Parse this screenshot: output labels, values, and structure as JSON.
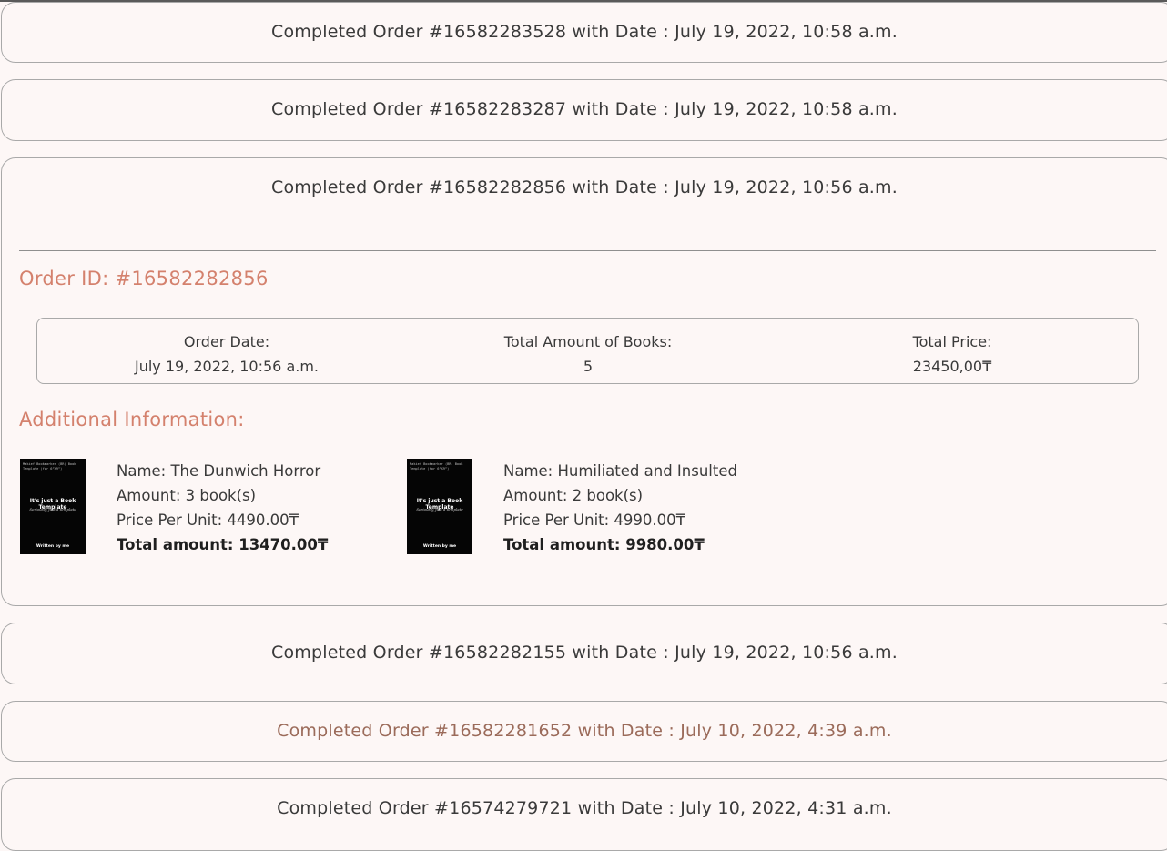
{
  "currency": "₸",
  "orders": [
    {
      "header": "Completed Order #16582283528 with Date : July 19, 2022, 10:58 a.m."
    },
    {
      "header": "Completed Order #16582283287 with Date : July 19, 2022, 10:58 a.m."
    },
    {
      "header": "Completed Order #16582282856 with Date : July 19, 2022, 10:56 a.m.",
      "expanded": true,
      "details": {
        "order_id_title": "Order ID: #16582282856",
        "order_date_label": "Order Date:",
        "order_date_value": "July 19, 2022, 10:56 a.m.",
        "total_books_label": "Total Amount of Books:",
        "total_books_value": "5",
        "total_price_label": "Total Price:",
        "total_price_value": "23450,00₸",
        "additional_title": "Additional Information:",
        "books": [
          {
            "name": "Name: The Dunwich Horror",
            "amount": "Amount: 3 book(s)",
            "price": "Price Per Unit: 4490.00₸",
            "total": "Total amount: 13470.00₸",
            "cover": {
              "top_text": "Makief Bookmarker (BR) Book Template (for 6”X9”)",
              "title": "It's just a Book Template",
              "subtitle": "Seriously, just a template",
              "author": "Written by me"
            }
          },
          {
            "name": "Name: Humiliated and Insulted",
            "amount": "Amount: 2 book(s)",
            "price": "Price Per Unit: 4990.00₸",
            "total": "Total amount: 9980.00₸",
            "cover": {
              "top_text": "Makief Bookmarker (BR) Book Template (for 6”X9”)",
              "title": "It's just a Book Template",
              "subtitle": "Seriously, just a template",
              "author": "Written by me"
            }
          }
        ]
      }
    },
    {
      "header": "Completed Order #16582282155 with Date : July 19, 2022, 10:56 a.m."
    },
    {
      "header": "Completed Order #16582281652 with Date : July 10, 2022, 4:39 a.m.",
      "hovered": true
    },
    {
      "header": "Completed Order #16574279721 with Date : July 10, 2022, 4:31 a.m."
    }
  ],
  "colors": {
    "background": "#fdf7f6",
    "accent": "#d4816d",
    "hover_text": "#9b6b5a",
    "border": "#a9a9a9",
    "cover": "#050505"
  }
}
